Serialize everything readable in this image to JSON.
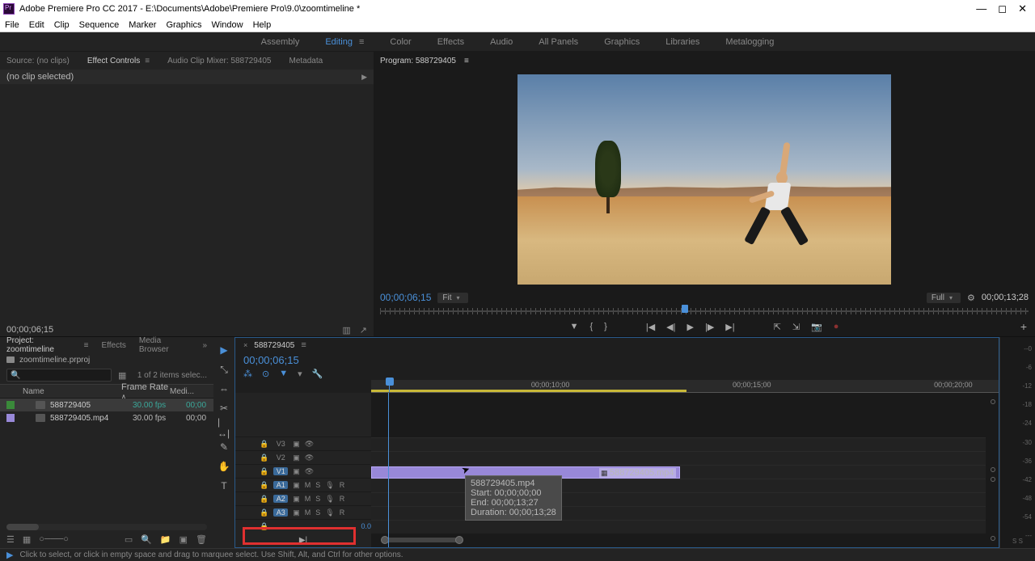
{
  "title": "Adobe Premiere Pro CC 2017 - E:\\Documents\\Adobe\\Premiere Pro\\9.0\\zoomtimeline *",
  "menu": [
    "File",
    "Edit",
    "Clip",
    "Sequence",
    "Marker",
    "Graphics",
    "Window",
    "Help"
  ],
  "workspaces": [
    "Assembly",
    "Editing",
    "Color",
    "Effects",
    "Audio",
    "All Panels",
    "Graphics",
    "Libraries",
    "Metalogging"
  ],
  "workspace_active": 1,
  "source_panel": {
    "tabs": [
      "Source: (no clips)",
      "Effect Controls",
      "Audio Clip Mixer: 588729405",
      "Metadata"
    ],
    "active_tab": 1,
    "noclip": "(no clip selected)",
    "footer_tc": "00;00;06;15"
  },
  "program_panel": {
    "title": "Program: 588729405",
    "timecode": "00;00;06;15",
    "fit": "Fit",
    "quality": "Full",
    "duration": "00;00;13;28",
    "playhead_pct": 46.5
  },
  "project_panel": {
    "tabs": [
      "Project: zoomtimeline",
      "Effects",
      "Media Browser"
    ],
    "active_tab": 0,
    "bin": "zoomtimeline.prproj",
    "selection": "1 of 2 items selec...",
    "columns": [
      "Name",
      "Frame Rate",
      "Medi..."
    ],
    "items": [
      {
        "color": "green",
        "name": "588729405",
        "fr": "30.00 fps",
        "fr_teal": true,
        "start": "00;00",
        "selected": true
      },
      {
        "color": "purple",
        "name": "588729405.mp4",
        "fr": "30.00 fps",
        "fr_teal": false,
        "start": "00;00",
        "selected": false
      }
    ]
  },
  "timeline": {
    "sequence": "588729405",
    "timecode": "00;00;06;15",
    "ruler_labels": [
      {
        "t": "00;00;10;00",
        "pct": 25.5
      },
      {
        "t": "00;00;15;00",
        "pct": 57.6
      },
      {
        "t": "00;00;20;00",
        "pct": 89.7
      }
    ],
    "playhead_pct": 2.8,
    "clip_end_pct": 50.2,
    "video_tracks": [
      "V3",
      "V2",
      "V1"
    ],
    "audio_tracks": [
      "A1",
      "A2",
      "A3"
    ],
    "clip": {
      "name": "588729405.mp4"
    },
    "tooltip": {
      "l1": "588729405.mp4",
      "l2": "Start: 00;00;00;00",
      "l3": "End: 00;00;13;27",
      "l4": "Duration: 00;00;13;28"
    },
    "master_gain": "0.0"
  },
  "meter_ticks": [
    "--0",
    "-6",
    "-12",
    "-18",
    "-24",
    "-30",
    "-36",
    "-42",
    "-48",
    "-54",
    "---"
  ],
  "meter_label": "S  S",
  "status": "Click to select, or click in empty space and drag to marquee select. Use Shift, Alt, and Ctrl for other options."
}
